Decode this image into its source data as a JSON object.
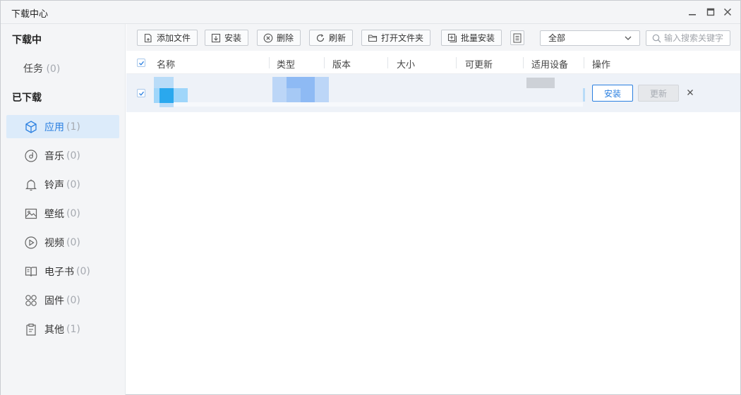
{
  "window": {
    "title": "下载中心"
  },
  "sidebar": {
    "downloading_heading": "下载中心",
    "downloading_section": "下载中",
    "task": {
      "label": "任务",
      "count": "(0)"
    },
    "downloaded_section": "已下载",
    "items": [
      {
        "label": "应用",
        "count": "(1)",
        "icon": "app-cube-icon",
        "active": true
      },
      {
        "label": "音乐",
        "count": "(0)",
        "icon": "music-disc-icon"
      },
      {
        "label": "铃声",
        "count": "(0)",
        "icon": "bell-icon"
      },
      {
        "label": "壁纸",
        "count": "(0)",
        "icon": "image-icon"
      },
      {
        "label": "视频",
        "count": "(0)",
        "icon": "video-play-icon"
      },
      {
        "label": "电子书",
        "count": "(0)",
        "icon": "book-icon"
      },
      {
        "label": "固件",
        "count": "(0)",
        "icon": "firmware-grid-icon"
      },
      {
        "label": "其他",
        "count": "(1)",
        "icon": "clipboard-icon"
      }
    ]
  },
  "toolbar": {
    "add_file": "添加文件",
    "install": "安装",
    "delete": "删除",
    "refresh": "刷新",
    "open_folder": "打开文件夹",
    "batch_install": "批量安装",
    "filter_value": "全部",
    "search_placeholder": "输入搜索关键字"
  },
  "table": {
    "columns": [
      "名称",
      "类型",
      "版本",
      "大小",
      "可更新",
      "适用设备",
      "操作"
    ],
    "rows": [
      {
        "checked": true,
        "install_label": "安装",
        "update_label": "更新"
      }
    ]
  },
  "colors": {
    "accent": "#2a7fe0",
    "sidebar_bg": "#f4f5f7",
    "active_bg": "#dcebfa",
    "row_bg": "#eef2f8"
  }
}
